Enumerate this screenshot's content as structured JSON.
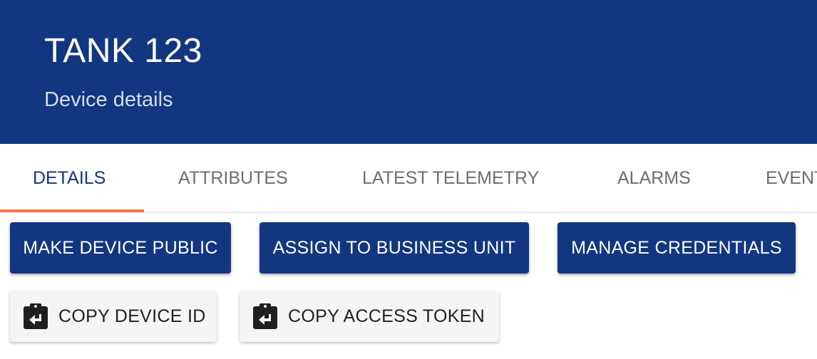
{
  "header": {
    "title": "TANK 123",
    "subtitle": "Device details",
    "background_color": "#133680"
  },
  "tabs": [
    {
      "label": "DETAILS",
      "active": true
    },
    {
      "label": "ATTRIBUTES",
      "active": false
    },
    {
      "label": "LATEST TELEMETRY",
      "active": false
    },
    {
      "label": "ALARMS",
      "active": false
    },
    {
      "label": "EVENTS",
      "active": false
    }
  ],
  "tab_indicator_color": "#f07c4e",
  "actions": {
    "make_public_label": "MAKE DEVICE PUBLIC",
    "assign_label": "ASSIGN TO BUSINESS UNIT",
    "manage_credentials_label": "MANAGE CREDENTIALS",
    "copy_device_id_label": "COPY DEVICE ID",
    "copy_access_token_label": "COPY ACCESS TOKEN",
    "copy_icon": "clipboard-arrow-left-icon",
    "primary_color": "#133680"
  }
}
